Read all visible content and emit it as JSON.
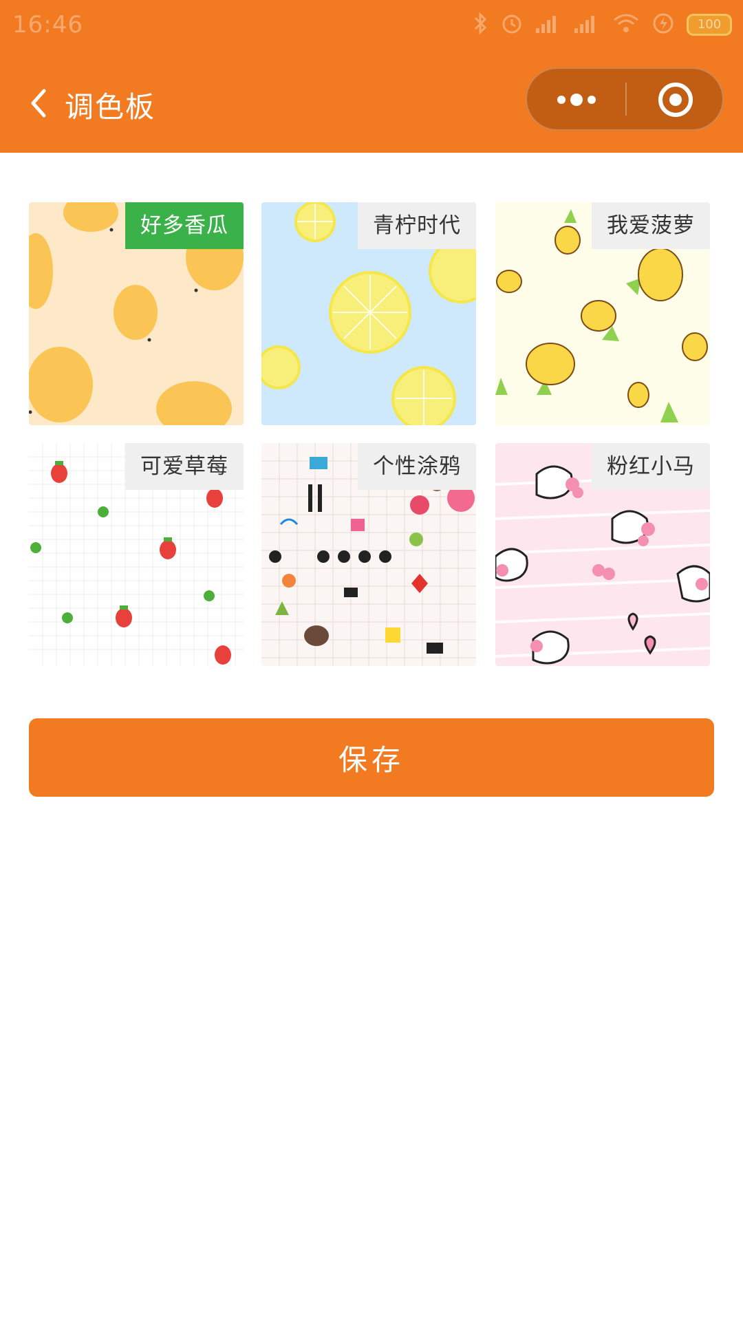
{
  "status_bar": {
    "time": "16:46",
    "battery": "100"
  },
  "nav": {
    "title": "调色板",
    "back_icon": "chevron-left-icon",
    "more_icon": "more-dots-icon",
    "close_icon": "target-circle-icon"
  },
  "themes": [
    {
      "label": "好多香瓜",
      "selected": true,
      "pattern": "melon"
    },
    {
      "label": "青柠时代",
      "selected": false,
      "pattern": "lemon"
    },
    {
      "label": "我爱菠萝",
      "selected": false,
      "pattern": "pineapple"
    },
    {
      "label": "可爱草莓",
      "selected": false,
      "pattern": "strawberry"
    },
    {
      "label": "个性涂鸦",
      "selected": false,
      "pattern": "doodle"
    },
    {
      "label": "粉红小马",
      "selected": false,
      "pattern": "unicorn"
    }
  ],
  "save_label": "保存",
  "colors": {
    "accent": "#f27b21",
    "selected_tag": "#3bb14a",
    "tag_bg": "#efefef"
  }
}
